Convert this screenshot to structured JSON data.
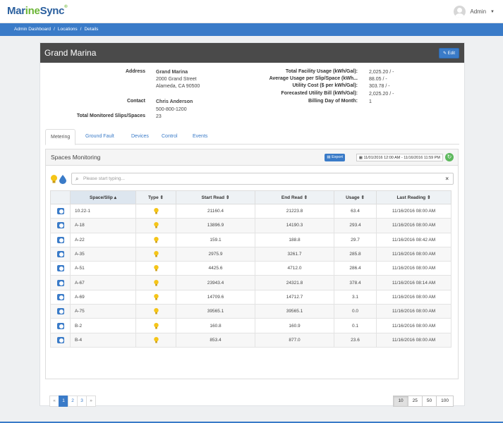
{
  "brand": {
    "part1": "Mar",
    "part2": "ine",
    "part3": "Sync",
    "tm": "®"
  },
  "user": {
    "name": "Admin"
  },
  "breadcrumb": [
    "Admin Dashboard",
    "Locations",
    "Details"
  ],
  "location": {
    "title": "Grand Marina",
    "edit_label": "Edit",
    "address_label": "Address",
    "address_lines": [
      "Grand Marina",
      "2000 Grand Street",
      "Alameda, CA 90500"
    ],
    "contact_label": "Contact",
    "contact_name": "Chris Anderson",
    "contact_phone": "500-800-1200",
    "slips_label": "Total Monitored Slips/Spaces",
    "slips_value": "23",
    "stats": [
      {
        "label": "Total Facility Usage (kWh/Gal):",
        "value": "2,025.20 / -"
      },
      {
        "label": "Average Usage per Slip/Space (kWh...",
        "value": "88.05 / -"
      },
      {
        "label": "Utility Cost ($ per kWh/Gal):",
        "value": "303.78 / -"
      },
      {
        "label": "Forecasted Utility Bill (kWh/Gal):",
        "value": "2,025.20 / -"
      },
      {
        "label": "Billing Day of Month:",
        "value": "1"
      }
    ]
  },
  "tabs": [
    "Metering",
    "Ground Fault",
    "Devices",
    "Control",
    "Events"
  ],
  "panel": {
    "title": "Spaces Monitoring",
    "export_label": "Export",
    "date_range": "11/01/2016 12:00 AM - 11/16/2016 11:59 PM",
    "search_placeholder": "Please start typing..."
  },
  "table": {
    "headers": [
      "Space/Slip",
      "Type",
      "Start Read",
      "End Read",
      "Usage",
      "Last Reading"
    ],
    "rows": [
      [
        "10.22-1",
        "21160.4",
        "21223.8",
        "63.4",
        "11/16/2016 08:00 AM"
      ],
      [
        "A-18",
        "13896.9",
        "14190.3",
        "293.4",
        "11/16/2016 08:00 AM"
      ],
      [
        "A-22",
        "159.1",
        "188.8",
        "29.7",
        "11/16/2016 08:42 AM"
      ],
      [
        "A-35",
        "2975.9",
        "3261.7",
        "285.8",
        "11/16/2016 08:00 AM"
      ],
      [
        "A-51",
        "4425.6",
        "4712.0",
        "286.4",
        "11/16/2016 08:00 AM"
      ],
      [
        "A-67",
        "23943.4",
        "24321.8",
        "378.4",
        "11/16/2016 08:14 AM"
      ],
      [
        "A-69",
        "14709.6",
        "14712.7",
        "3.1",
        "11/16/2016 08:00 AM"
      ],
      [
        "A-75",
        "39565.1",
        "39565.1",
        "0.0",
        "11/16/2016 08:00 AM"
      ],
      [
        "B-2",
        "160.8",
        "160.9",
        "0.1",
        "11/16/2016 08:00 AM"
      ],
      [
        "B-4",
        "853.4",
        "877.0",
        "23.6",
        "11/16/2016 08:00 AM"
      ]
    ]
  },
  "pagination": {
    "prev": "«",
    "pages": [
      "1",
      "2",
      "3"
    ],
    "next": "»",
    "current": "1"
  },
  "page_sizes": [
    "10",
    "25",
    "50",
    "100"
  ],
  "colors": {
    "accent": "#3a7bc8",
    "header_dark": "#4a4a4a",
    "bulb": "#f5c518",
    "drop": "#3a7bc8"
  }
}
